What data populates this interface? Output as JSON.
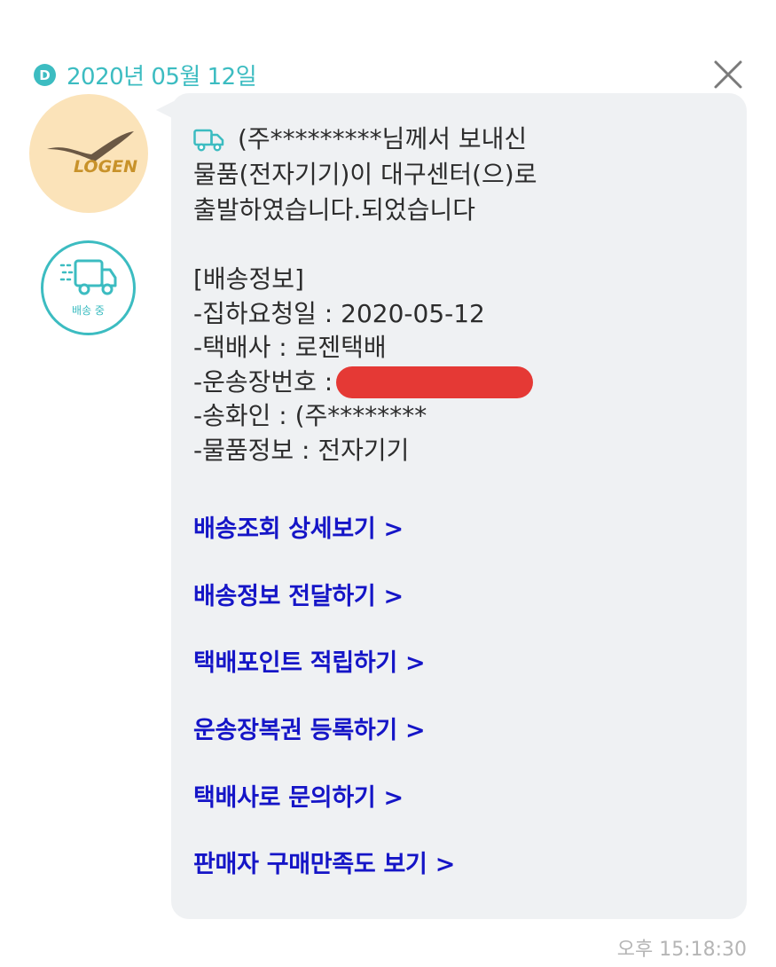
{
  "header": {
    "badge": "D",
    "date": "2020년 05월 12일"
  },
  "sender": {
    "logo_text": "LOGEN",
    "status_label": "배송 중"
  },
  "message": {
    "intro": "(주*********님께서 보내신\n물품(전자기기)이 대구센터(으)로\n출발하였습니다.되었습니다",
    "section_title": "[배송정보]",
    "pickup_date": "-집하요청일 : 2020-05-12",
    "courier": "-택배사 : 로젠택배",
    "tracking_label": "-운송장번호 :",
    "shipper": "-송화인 : (주********",
    "item_info": "-물품정보 : 전자기기"
  },
  "links": [
    "배송조회 상세보기 >",
    "배송정보 전달하기 >",
    "택배포인트 적립하기 >",
    "운송장복권 등록하기 >",
    "택배사로 문의하기 >",
    "판매자 구매만족도 보기 >"
  ],
  "footer": {
    "timestamp": "오후 15:18:30"
  },
  "colors": {
    "accent": "#3cbcc1",
    "link": "#1515c7",
    "bubble": "#eff1f3",
    "redaction": "#e53935"
  }
}
